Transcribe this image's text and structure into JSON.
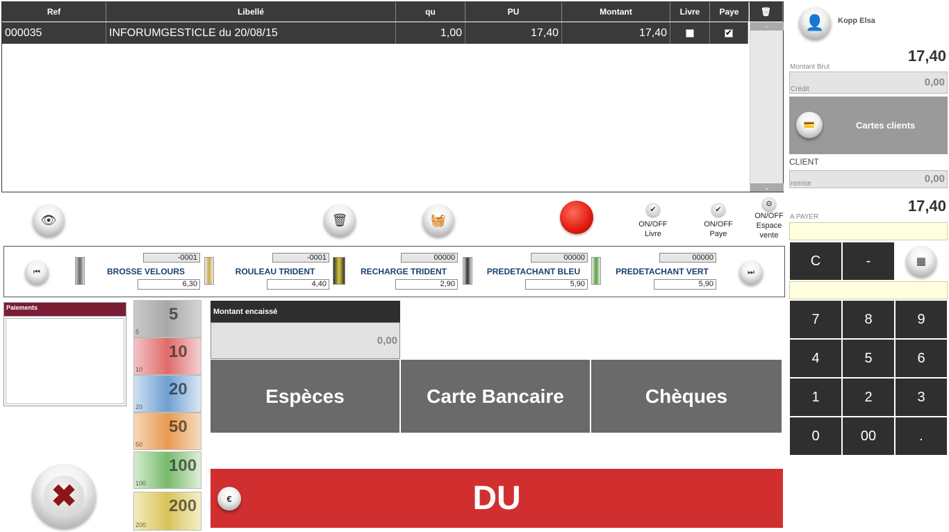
{
  "table": {
    "headers": [
      "Ref",
      "Libellé",
      "qu",
      "PU",
      "Montant",
      "Livre",
      "Paye"
    ],
    "rows": [
      {
        "ref": "000035",
        "libelle": "INFORUMGESTICLE du 20/08/15",
        "qu": "1,00",
        "pu": "17,40",
        "montant": "17,40",
        "livre": false,
        "paye": true
      }
    ]
  },
  "toolbar": {
    "toggle_livre": "ON/OFF\nLivre",
    "toggle_paye": "ON/OFF\nPaye",
    "toggle_espace": "ON/OFF\nEspace\nvente"
  },
  "products": [
    {
      "name": "BROSSE VELOURS",
      "count": "-0001",
      "price": "6,30"
    },
    {
      "name": "ROULEAU TRIDENT",
      "count": "-0001",
      "price": "4,40"
    },
    {
      "name": "RECHARGE TRIDENT",
      "count": "00000",
      "price": "2,90"
    },
    {
      "name": "PREDETACHANT BLEU",
      "count": "00000",
      "price": "5,90"
    },
    {
      "name": "PREDETACHANT VERT",
      "count": "00000",
      "price": "5,90"
    }
  ],
  "payments": {
    "title": "Paiements"
  },
  "notes": [
    "5",
    "10",
    "20",
    "50",
    "100",
    "200"
  ],
  "encaisse": {
    "label": "Montant encaissé",
    "value": "0,00"
  },
  "pay_methods": [
    "Espèces",
    "Carte Bancaire",
    "Chèques"
  ],
  "du_label": "DU",
  "right": {
    "user": "Kopp Elsa",
    "montant_brut": "17,40",
    "montant_brut_label": "Montant Brut",
    "credit": "0,00",
    "credit_label": "Crédit",
    "cartes_clients": "Cartes clients",
    "client_label": "CLIENT",
    "remise": "0,00",
    "remise_label": "remise",
    "a_payer": "17,40",
    "a_payer_label": "A PAYER"
  },
  "keypad": [
    "C",
    "-",
    "7",
    "8",
    "9",
    "4",
    "5",
    "6",
    "1",
    "2",
    "3",
    "0",
    "00",
    "."
  ],
  "colors": {
    "header": "#3a3a3a",
    "pay_button": "#6a6a6a",
    "du": "#d12f2f",
    "paiements_header": "#7a1d34",
    "keypad": "#2f2f2f"
  }
}
